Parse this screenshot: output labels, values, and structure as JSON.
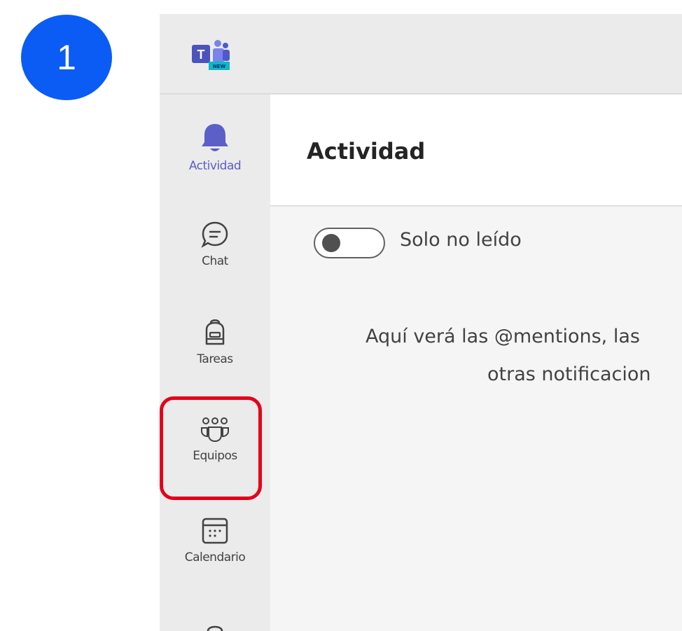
{
  "step_badge": "1",
  "app": {
    "logo_name": "microsoft-teams-new-logo"
  },
  "rail": {
    "items": [
      {
        "id": "activity",
        "label": "Actividad",
        "icon": "bell-icon",
        "active": true
      },
      {
        "id": "chat",
        "label": "Chat",
        "icon": "chat-icon",
        "active": false
      },
      {
        "id": "tasks",
        "label": "Tareas",
        "icon": "backpack-icon",
        "active": false
      },
      {
        "id": "teams",
        "label": "Equipos",
        "icon": "teams-people-icon",
        "active": false,
        "highlighted": true
      },
      {
        "id": "calendar",
        "label": "Calendario",
        "icon": "calendar-icon",
        "active": false
      }
    ]
  },
  "content": {
    "title": "Actividad",
    "toggle_label": "Solo no leído",
    "toggle_on": false,
    "empty_line1": "Aquí verá las @mentions, las",
    "empty_line2": "otras notificacion"
  },
  "colors": {
    "accent": "#5b5fc7",
    "badge": "#0b5cf5",
    "highlight": "#e4001b"
  }
}
